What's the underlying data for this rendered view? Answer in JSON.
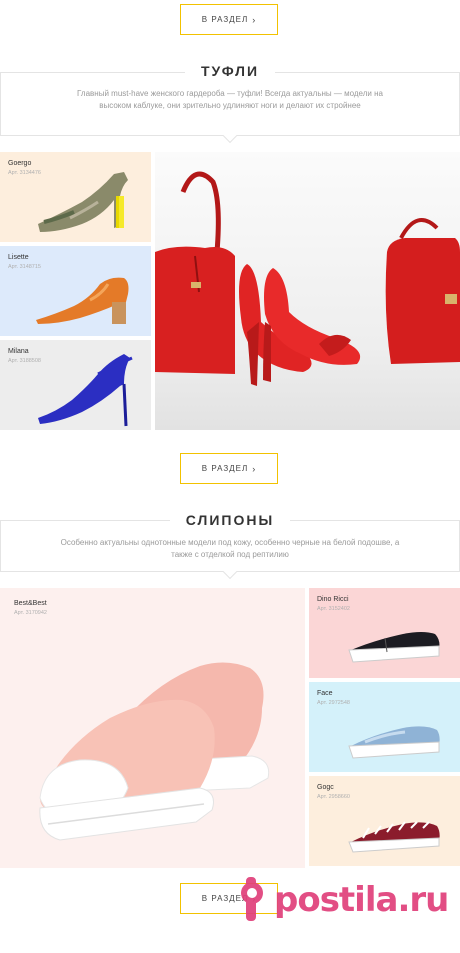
{
  "buttons": {
    "section_label": "В РАЗДЕЛ"
  },
  "pumps": {
    "title": "ТУФЛИ",
    "description": "Главный must-have женского гардероба — туфли! Всегда актуальны — модели на высоком каблуке, они зрительно удлиняют ноги и делают их стройнее",
    "products": [
      {
        "name": "Goergo",
        "article": "Арт. 3134476"
      },
      {
        "name": "Lisette",
        "article": "Арт. 3148715"
      },
      {
        "name": "Milana",
        "article": "Арт. 3188508"
      }
    ]
  },
  "slipons": {
    "title": "СЛИПОНЫ",
    "description": "Особенно актуальны однотонные модели под кожу, особенно черные на белой подошве, а также с отделкой под рептилию",
    "products": [
      {
        "name": "Best&Best",
        "article": "Арт. 3170942"
      },
      {
        "name": "Dino Ricci",
        "article": "Арт. 3152402"
      },
      {
        "name": "Face",
        "article": "Арт. 2972548"
      },
      {
        "name": "Gogc",
        "article": "Арт. 2958660"
      }
    ]
  },
  "watermark": "postila.ru",
  "colors": {
    "accent": "#f2c200",
    "peach": "#fdeedd",
    "light_blue": "#ddeafb",
    "light_gray": "#ededed",
    "pink": "#fbd6d6",
    "cyan": "#d4f1fa"
  }
}
